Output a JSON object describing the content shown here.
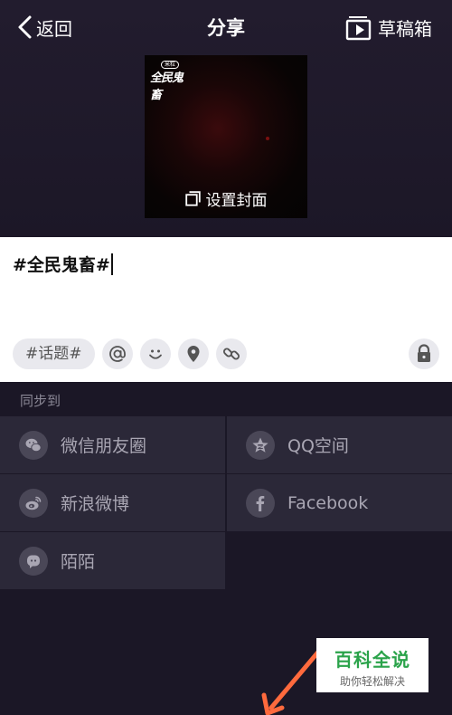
{
  "nav": {
    "back_label": "返回",
    "title": "分享",
    "drafts_label": "草稿箱"
  },
  "cover": {
    "logo_badge": "米粒",
    "logo_text": "全民鬼畜",
    "set_cover_label": "设置封面"
  },
  "caption": {
    "text": "#全民鬼畜#"
  },
  "tools": {
    "topic_label": "#话题#",
    "icons": [
      "at-icon",
      "emoji-icon",
      "location-icon",
      "link-icon",
      "lock-icon"
    ]
  },
  "sync": {
    "label": "同步到",
    "targets": [
      {
        "label": "微信朋友圈",
        "icon": "wechat-moments-icon"
      },
      {
        "label": "QQ空间",
        "icon": "qzone-icon"
      },
      {
        "label": "新浪微博",
        "icon": "weibo-icon"
      },
      {
        "label": "Facebook",
        "icon": "facebook-icon"
      },
      {
        "label": "陌陌",
        "icon": "momo-icon"
      }
    ]
  },
  "watermark": {
    "title": "百科全说",
    "subtitle": "助你轻松解决"
  },
  "colors": {
    "background": "#1b1726",
    "cell": "#2b2838",
    "accent_green": "#2aa34a",
    "arrow": "#ff6a3d"
  }
}
